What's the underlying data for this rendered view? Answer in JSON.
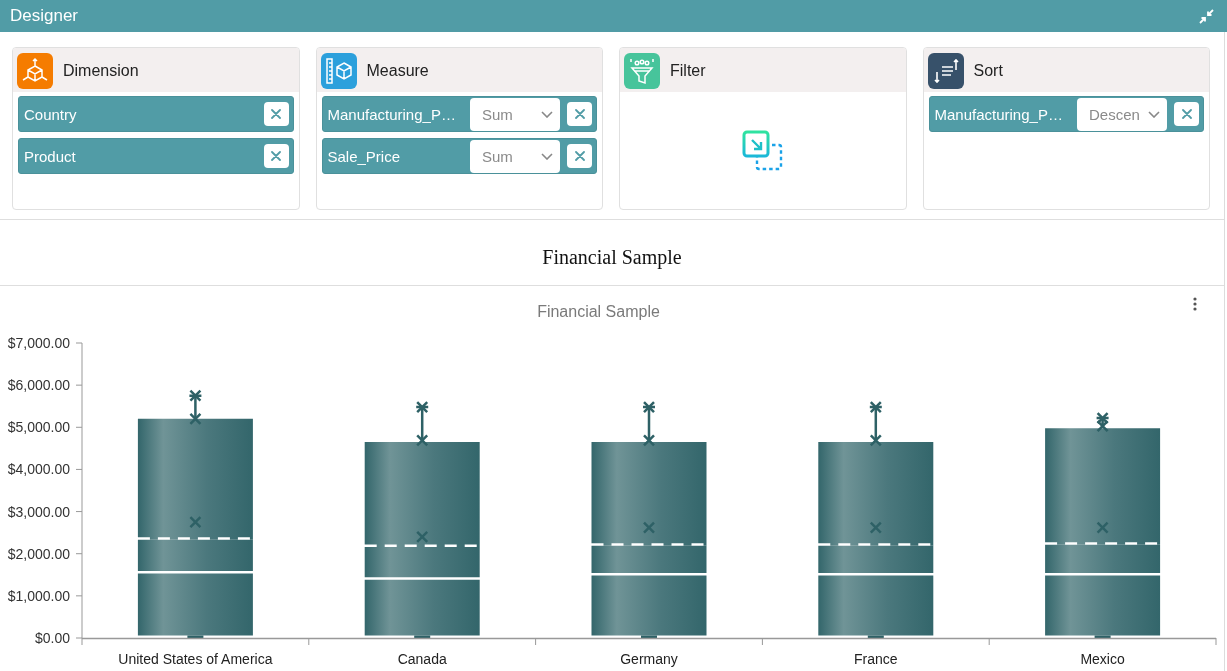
{
  "window": {
    "title": "Designer"
  },
  "panels": [
    {
      "kind": "dimension",
      "title": "Dimension",
      "items": [
        {
          "label": "Country"
        },
        {
          "label": "Product"
        }
      ]
    },
    {
      "kind": "measure",
      "title": "Measure",
      "items": [
        {
          "label": "Manufacturing_P…",
          "dropdown": "Sum"
        },
        {
          "label": "Sale_Price",
          "dropdown": "Sum"
        }
      ]
    },
    {
      "kind": "filter",
      "title": "Filter"
    },
    {
      "kind": "sort",
      "title": "Sort",
      "items": [
        {
          "label": "Manufacturing_P…",
          "dropdown": "Descen"
        }
      ]
    }
  ],
  "report_title": "Financial Sample",
  "chart": {
    "title": "Financial Sample",
    "chart_data": {
      "type": "bar",
      "stacked": true,
      "categories": [
        "United States of America",
        "Canada",
        "Germany",
        "France",
        "Mexico"
      ],
      "ylim": [
        0,
        7000
      ],
      "yticks": [
        {
          "value": 0,
          "label": "$0.00"
        },
        {
          "value": 1000,
          "label": "$1,000.00"
        },
        {
          "value": 2000,
          "label": "$2,000.00"
        },
        {
          "value": 3000,
          "label": "$3,000.00"
        },
        {
          "value": 4000,
          "label": "$4,000.00"
        },
        {
          "value": 5000,
          "label": "$5,000.00"
        },
        {
          "value": 6000,
          "label": "$6,000.00"
        },
        {
          "value": 7000,
          "label": "$7,000.00"
        }
      ],
      "series": [
        {
          "type": "bar",
          "color": "#33666b",
          "values": [
            1560,
            1410,
            1510,
            1510,
            1510
          ]
        },
        {
          "type": "bar",
          "color": "#33666b",
          "values": [
            800,
            780,
            710,
            710,
            730
          ]
        },
        {
          "type": "bar",
          "color": "#33666b",
          "values": [
            2840,
            2460,
            2430,
            2430,
            2740
          ]
        },
        {
          "type": "scatter",
          "marker": "cross",
          "color": "#2e6166",
          "values": [
            5750,
            5480,
            5480,
            5480,
            5220
          ]
        },
        {
          "type": "scatter",
          "marker": "cross",
          "color": "#2e6166",
          "values": [
            5200,
            4690,
            4690,
            4690,
            5030
          ]
        },
        {
          "type": "scatter",
          "marker": "cross",
          "color": "#2e6166",
          "values": [
            2750,
            2400,
            2620,
            2620,
            2620
          ]
        }
      ]
    }
  }
}
